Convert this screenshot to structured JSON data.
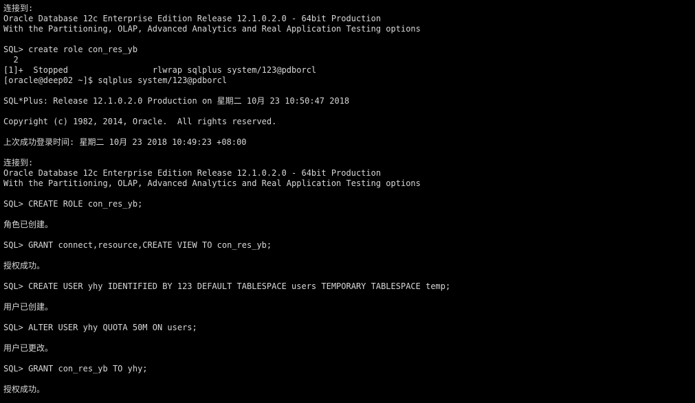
{
  "terminal": {
    "lines": [
      "连接到:",
      "Oracle Database 12c Enterprise Edition Release 12.1.0.2.0 - 64bit Production",
      "With the Partitioning, OLAP, Advanced Analytics and Real Application Testing options",
      "",
      "SQL> create role con_res_yb",
      "  2",
      "[1]+  Stopped                 rlwrap sqlplus system/123@pdborcl",
      "[oracle@deep02 ~]$ sqlplus system/123@pdborcl",
      "",
      "SQL*Plus: Release 12.1.0.2.0 Production on 星期二 10月 23 10:50:47 2018",
      "",
      "Copyright (c) 1982, 2014, Oracle.  All rights reserved.",
      "",
      "上次成功登录时间: 星期二 10月 23 2018 10:49:23 +08:00",
      "",
      "连接到:",
      "Oracle Database 12c Enterprise Edition Release 12.1.0.2.0 - 64bit Production",
      "With the Partitioning, OLAP, Advanced Analytics and Real Application Testing options",
      "",
      "SQL> CREATE ROLE con_res_yb;",
      "",
      "角色已创建。",
      "",
      "SQL> GRANT connect,resource,CREATE VIEW TO con_res_yb;",
      "",
      "授权成功。",
      "",
      "SQL> CREATE USER yhy IDENTIFIED BY 123 DEFAULT TABLESPACE users TEMPORARY TABLESPACE temp;",
      "",
      "用户已创建。",
      "",
      "SQL> ALTER USER yhy QUOTA 50M ON users;",
      "",
      "用户已更改。",
      "",
      "SQL> GRANT con_res_yb TO yhy;",
      "",
      "授权成功。"
    ]
  }
}
